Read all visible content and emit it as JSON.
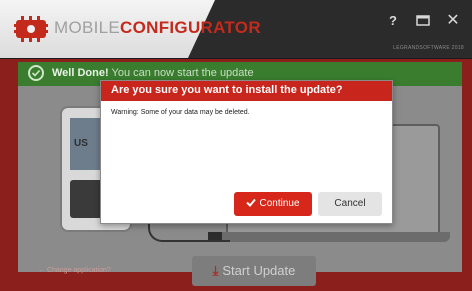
{
  "window": {
    "brand_prefix": "MOBILE",
    "brand_suffix": "CONFIGURATOR",
    "copyright": "LEGRANDSOFTWARE 2018",
    "help_label": "?",
    "restore_icon": "restore-window-icon",
    "close_label": "✕"
  },
  "notification": {
    "strong": "Well Done!",
    "text": "You can now start the update",
    "icon": "check-circle-icon",
    "color": "#3a7d2f"
  },
  "background": {
    "phone_screen_text": "US",
    "change_app_label": "← Change application?",
    "start_update_label": "Start Update",
    "start_update_icon": "download-icon"
  },
  "dialog": {
    "title": "Are you sure you want to install the update?",
    "message": "Warning: Some of your data may be deleted.",
    "continue_label": "Continue",
    "cancel_label": "Cancel",
    "accent_color": "#c8261d"
  }
}
